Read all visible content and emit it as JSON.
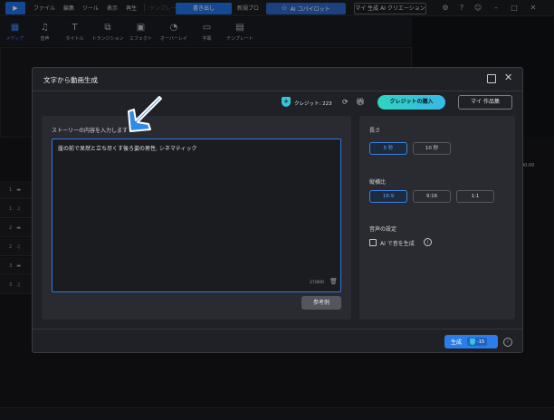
{
  "menubar": {
    "logo": "",
    "items": [
      "ファイル",
      "編集",
      "ツール",
      "表示",
      "再生"
    ],
    "faded_item": "テンプレート",
    "export_label": "書き出し",
    "new_project_label": "新規プロ",
    "ai_copilot_label": "AI コパイロット",
    "my_ai_creation_label": "マイ 生成 AI クリエーション"
  },
  "tools": [
    {
      "label": "メディア",
      "icon": "media-icon",
      "active": true
    },
    {
      "label": "音声",
      "icon": "music-note-icon",
      "active": false
    },
    {
      "label": "タイトル",
      "icon": "title-t-icon",
      "active": false
    },
    {
      "label": "トランジション",
      "icon": "transition-icon",
      "active": false
    },
    {
      "label": "エフェクト",
      "icon": "effect-icon",
      "active": false
    },
    {
      "label": "オーバーレイ",
      "icon": "overlay-icon",
      "active": false
    },
    {
      "label": "字幕",
      "icon": "subtitle-icon",
      "active": false
    },
    {
      "label": "テンプレート",
      "icon": "template-icon",
      "active": false
    }
  ],
  "timeline": {
    "time_label": "40:00",
    "track_numbers": [
      "1",
      "1",
      "2",
      "2",
      "3",
      "3"
    ]
  },
  "dialog": {
    "title": "文字から動画生成",
    "credit_label": "クレジット: 223",
    "buy_credit_label": "クレジットの購入",
    "my_works_label": "マイ 作品集",
    "story": {
      "label": "ストーリーの内容を入力します",
      "text": "崖の前で呆然と立ち尽くす後ろ姿の男性, シネマティック",
      "count": "27/800"
    },
    "example_button": "参考例",
    "length": {
      "label": "長さ",
      "options": [
        "5 秒",
        "10 秒"
      ],
      "selected": "5 秒"
    },
    "aspect": {
      "label": "縦横比",
      "options": [
        "16:9",
        "9:16",
        "1:1"
      ],
      "selected": "16:9"
    },
    "audio": {
      "label": "音声の設定",
      "checkbox_label": "AI で音を生成",
      "checked": false
    },
    "generate_label": "生成",
    "generate_cost": "-15"
  },
  "colors": {
    "accent": "#2b7de9",
    "annotation_arrow": "#2f8be6",
    "credit_teal": "#35c6d8"
  }
}
